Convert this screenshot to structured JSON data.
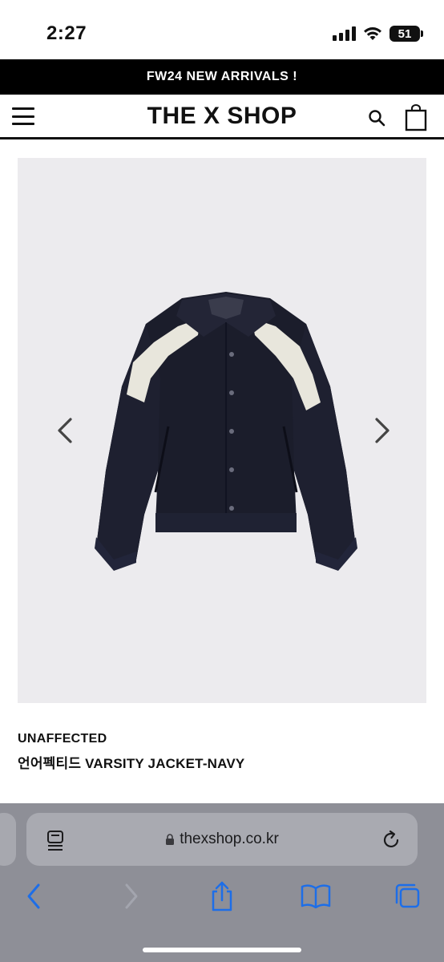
{
  "status_bar": {
    "time": "2:27",
    "battery": "51"
  },
  "announcement": {
    "text": "FW24 NEW ARRIVALS !"
  },
  "header": {
    "title": "THE X SHOP"
  },
  "product": {
    "brand": "UNAFFECTED",
    "name": "언어펙티드 VARSITY JACKET-NAVY"
  },
  "browser": {
    "url": "thexshop.co.kr"
  },
  "icons": {
    "menu": "hamburger-menu-icon",
    "search": "search-icon",
    "bag": "shopping-bag-icon",
    "prev": "chevron-left-icon",
    "next": "chevron-right-icon",
    "reader": "reader-mode-icon",
    "lock": "lock-icon",
    "reload": "reload-icon",
    "back": "back-icon",
    "forward": "forward-icon",
    "share": "share-icon",
    "bookmarks": "bookmarks-icon",
    "tabs": "tabs-icon"
  },
  "colors": {
    "announcement_bg": "#000000",
    "image_bg": "#ecebee",
    "jacket": "#1b1d2b",
    "jacket_panel": "#e8e6dc",
    "browser_bg": "#8e8f97",
    "safari_accent": "#1d6ee8"
  }
}
